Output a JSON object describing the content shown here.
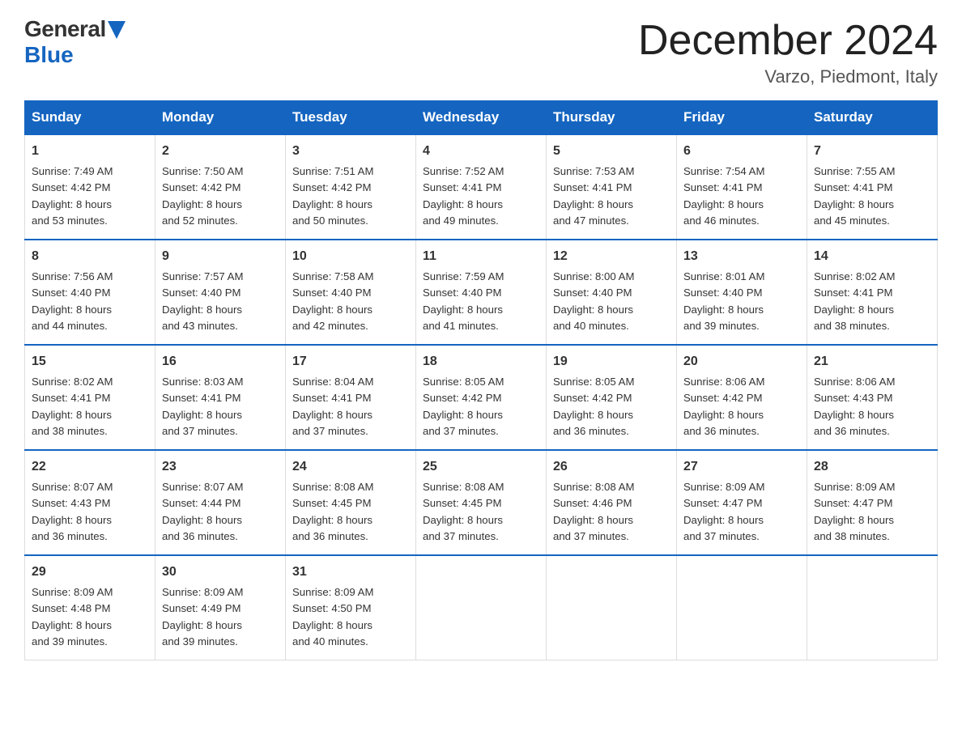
{
  "header": {
    "logo_general": "General",
    "logo_blue": "Blue",
    "month_title": "December 2024",
    "location": "Varzo, Piedmont, Italy"
  },
  "days_of_week": [
    "Sunday",
    "Monday",
    "Tuesday",
    "Wednesday",
    "Thursday",
    "Friday",
    "Saturday"
  ],
  "weeks": [
    [
      {
        "day": "1",
        "sunrise": "7:49 AM",
        "sunset": "4:42 PM",
        "daylight": "8 hours and 53 minutes."
      },
      {
        "day": "2",
        "sunrise": "7:50 AM",
        "sunset": "4:42 PM",
        "daylight": "8 hours and 52 minutes."
      },
      {
        "day": "3",
        "sunrise": "7:51 AM",
        "sunset": "4:42 PM",
        "daylight": "8 hours and 50 minutes."
      },
      {
        "day": "4",
        "sunrise": "7:52 AM",
        "sunset": "4:41 PM",
        "daylight": "8 hours and 49 minutes."
      },
      {
        "day": "5",
        "sunrise": "7:53 AM",
        "sunset": "4:41 PM",
        "daylight": "8 hours and 47 minutes."
      },
      {
        "day": "6",
        "sunrise": "7:54 AM",
        "sunset": "4:41 PM",
        "daylight": "8 hours and 46 minutes."
      },
      {
        "day": "7",
        "sunrise": "7:55 AM",
        "sunset": "4:41 PM",
        "daylight": "8 hours and 45 minutes."
      }
    ],
    [
      {
        "day": "8",
        "sunrise": "7:56 AM",
        "sunset": "4:40 PM",
        "daylight": "8 hours and 44 minutes."
      },
      {
        "day": "9",
        "sunrise": "7:57 AM",
        "sunset": "4:40 PM",
        "daylight": "8 hours and 43 minutes."
      },
      {
        "day": "10",
        "sunrise": "7:58 AM",
        "sunset": "4:40 PM",
        "daylight": "8 hours and 42 minutes."
      },
      {
        "day": "11",
        "sunrise": "7:59 AM",
        "sunset": "4:40 PM",
        "daylight": "8 hours and 41 minutes."
      },
      {
        "day": "12",
        "sunrise": "8:00 AM",
        "sunset": "4:40 PM",
        "daylight": "8 hours and 40 minutes."
      },
      {
        "day": "13",
        "sunrise": "8:01 AM",
        "sunset": "4:40 PM",
        "daylight": "8 hours and 39 minutes."
      },
      {
        "day": "14",
        "sunrise": "8:02 AM",
        "sunset": "4:41 PM",
        "daylight": "8 hours and 38 minutes."
      }
    ],
    [
      {
        "day": "15",
        "sunrise": "8:02 AM",
        "sunset": "4:41 PM",
        "daylight": "8 hours and 38 minutes."
      },
      {
        "day": "16",
        "sunrise": "8:03 AM",
        "sunset": "4:41 PM",
        "daylight": "8 hours and 37 minutes."
      },
      {
        "day": "17",
        "sunrise": "8:04 AM",
        "sunset": "4:41 PM",
        "daylight": "8 hours and 37 minutes."
      },
      {
        "day": "18",
        "sunrise": "8:05 AM",
        "sunset": "4:42 PM",
        "daylight": "8 hours and 37 minutes."
      },
      {
        "day": "19",
        "sunrise": "8:05 AM",
        "sunset": "4:42 PM",
        "daylight": "8 hours and 36 minutes."
      },
      {
        "day": "20",
        "sunrise": "8:06 AM",
        "sunset": "4:42 PM",
        "daylight": "8 hours and 36 minutes."
      },
      {
        "day": "21",
        "sunrise": "8:06 AM",
        "sunset": "4:43 PM",
        "daylight": "8 hours and 36 minutes."
      }
    ],
    [
      {
        "day": "22",
        "sunrise": "8:07 AM",
        "sunset": "4:43 PM",
        "daylight": "8 hours and 36 minutes."
      },
      {
        "day": "23",
        "sunrise": "8:07 AM",
        "sunset": "4:44 PM",
        "daylight": "8 hours and 36 minutes."
      },
      {
        "day": "24",
        "sunrise": "8:08 AM",
        "sunset": "4:45 PM",
        "daylight": "8 hours and 36 minutes."
      },
      {
        "day": "25",
        "sunrise": "8:08 AM",
        "sunset": "4:45 PM",
        "daylight": "8 hours and 37 minutes."
      },
      {
        "day": "26",
        "sunrise": "8:08 AM",
        "sunset": "4:46 PM",
        "daylight": "8 hours and 37 minutes."
      },
      {
        "day": "27",
        "sunrise": "8:09 AM",
        "sunset": "4:47 PM",
        "daylight": "8 hours and 37 minutes."
      },
      {
        "day": "28",
        "sunrise": "8:09 AM",
        "sunset": "4:47 PM",
        "daylight": "8 hours and 38 minutes."
      }
    ],
    [
      {
        "day": "29",
        "sunrise": "8:09 AM",
        "sunset": "4:48 PM",
        "daylight": "8 hours and 39 minutes."
      },
      {
        "day": "30",
        "sunrise": "8:09 AM",
        "sunset": "4:49 PM",
        "daylight": "8 hours and 39 minutes."
      },
      {
        "day": "31",
        "sunrise": "8:09 AM",
        "sunset": "4:50 PM",
        "daylight": "8 hours and 40 minutes."
      },
      null,
      null,
      null,
      null
    ]
  ],
  "labels": {
    "sunrise": "Sunrise:",
    "sunset": "Sunset:",
    "daylight": "Daylight:"
  }
}
